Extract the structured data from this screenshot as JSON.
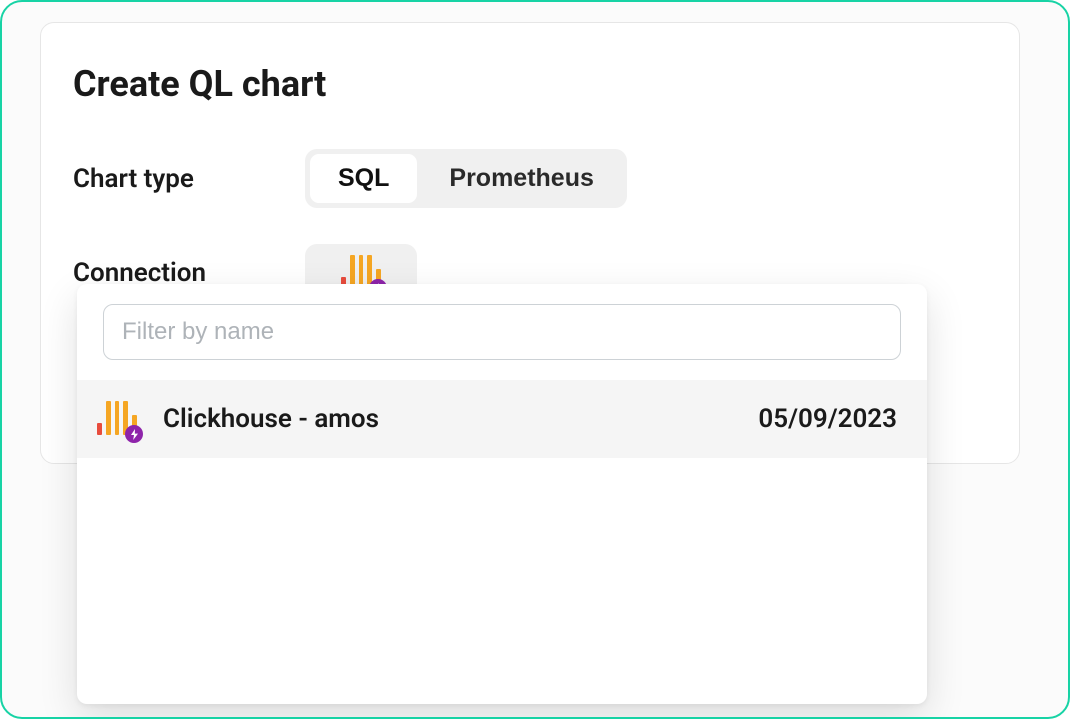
{
  "dialog": {
    "title": "Create QL chart"
  },
  "fields": {
    "chartType": {
      "label": "Chart type",
      "options": [
        "SQL",
        "Prometheus"
      ],
      "selected": "SQL"
    },
    "connection": {
      "label": "Connection",
      "iconName": "clickhouse-icon"
    }
  },
  "dropdown": {
    "filterPlaceholder": "Filter by name",
    "items": [
      {
        "label": "Clickhouse - amos",
        "date": "05/09/2023",
        "iconName": "clickhouse-icon"
      }
    ]
  }
}
